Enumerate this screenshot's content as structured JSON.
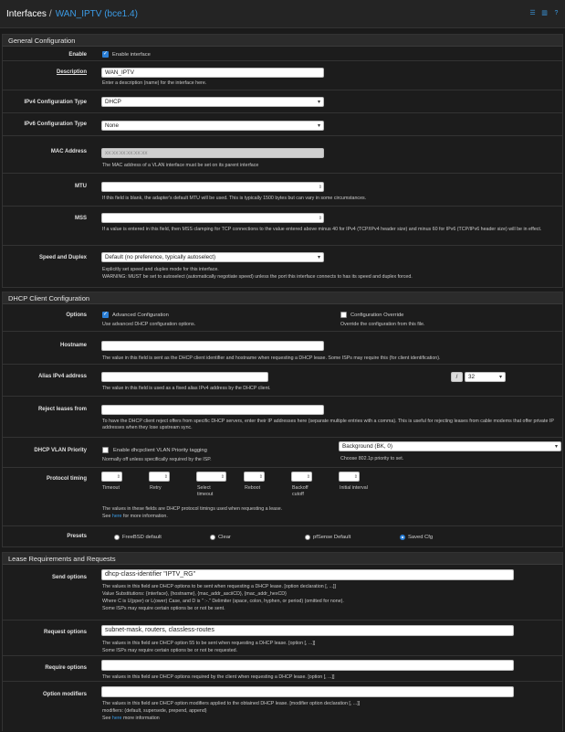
{
  "header": {
    "title": "Interfaces",
    "separator": "/",
    "subtitle": "WAN_IPTV (bce1.4)"
  },
  "general": {
    "heading": "General Configuration",
    "enable": {
      "label": "Enable",
      "text": "Enable interface"
    },
    "description": {
      "label": "Description",
      "value": "WAN_IPTV",
      "help": "Enter a description (name) for the interface here."
    },
    "ipv4": {
      "label": "IPv4 Configuration Type",
      "value": "DHCP"
    },
    "ipv6": {
      "label": "IPv6 Configuration Type",
      "value": "None"
    },
    "mac": {
      "label": "MAC Address",
      "placeholder": "xx:xx:xx:xx:xx:xx",
      "help": "The MAC address of a VLAN interface must be set on its parent interface"
    },
    "mtu": {
      "label": "MTU",
      "help": "If this field is blank, the adapter's default MTU will be used. This is typically 1500 bytes but can vary in some circumstances."
    },
    "mss": {
      "label": "MSS",
      "help": "If a value is entered in this field, then MSS clamping for TCP connections to the value entered above minus 40 for IPv4 (TCP/IPv4 header size) and minus 60 for IPv6 (TCP/IPv6 header size) will be in effect."
    },
    "speed": {
      "label": "Speed and Duplex",
      "value": "Default (no preference, typically autoselect)",
      "help1": "Explicitly set speed and duplex mode for this interface.",
      "help2": "WARNING: MUST be set to autoselect (automatically negotiate speed) unless the port this interface connects to has its speed and duplex forced."
    }
  },
  "dhcp": {
    "heading": "DHCP Client Configuration",
    "options": {
      "label": "Options",
      "adv": "Advanced Configuration",
      "adv_help": "Use advanced DHCP configuration options.",
      "override": "Configuration Override",
      "override_help": "Override the configuration from this file."
    },
    "hostname": {
      "label": "Hostname",
      "help": "The value in this field is sent as the DHCP client identifier and hostname when requesting a DHCP lease. Some ISPs may require this (for client identification)."
    },
    "alias": {
      "label": "Alias IPv4 address",
      "slash": "/",
      "mask": "32",
      "help": "The value in this field is used as a fixed alias IPv4 address by the DHCP client."
    },
    "reject": {
      "label": "Reject leases from",
      "help": "To have the DHCP client reject offers from specific DHCP servers, enter their IP addresses here (separate multiple entries with a comma). This is useful for rejecting leases from cable modems that offer private IP addresses when they lose upstream sync."
    },
    "vlan": {
      "label": "DHCP VLAN Priority",
      "text": "Enable dhcpclient VLAN Priority tagging",
      "help": "Normally off unless specifically required by the ISP.",
      "prio": "Background (BK, 0)",
      "prio_help": "Choose 802.1p priority to set."
    },
    "timing": {
      "label": "Protocol timing",
      "fields": [
        "Timeout",
        "Retry",
        "Select timeout",
        "Reboot",
        "Backoff cutoff",
        "Initial interval"
      ],
      "help": "The values in these fields are DHCP protocol timings used when requesting a lease.",
      "see": "See ",
      "here": "here",
      "more": " for more information."
    },
    "presets": {
      "label": "Presets",
      "items": [
        "FreeBSD default",
        "Clear",
        "pfSense Default",
        "Saved Cfg"
      ]
    }
  },
  "lease": {
    "heading": "Lease Requirements and Requests",
    "send": {
      "label": "Send options",
      "value": "dhcp-class-identifier \"IPTV_RG\"",
      "help1": "The values in this field are DHCP options to be sent when requesting a DHCP lease. [option declaration [, ...]]",
      "help2": "Value Substitutions: {interface}, {hostname}, {mac_addr_asciiCD}, {mac_addr_hexCD}",
      "help3": "Where C is U(pper) or L(ower) Case, and D is \" :-.\" Delimiter (space, colon, hyphen, or period) (omitted for none).",
      "help4": "Some ISPs may require certain options be or not be sent."
    },
    "request": {
      "label": "Request options",
      "value": "subnet-mask, routers, classless-routes",
      "help1": "The values in this field are DHCP option 55 to be sent when requesting a DHCP lease. [option [, ...]]",
      "help2": "Some ISPs may require certain options be or not be requested."
    },
    "require": {
      "label": "Require options",
      "help": "The values in this field are DHCP options required by the client when requesting a DHCP lease. [option [, ...]]"
    },
    "modifiers": {
      "label": "Option modifiers",
      "help1": "The values in this field are DHCP option modifiers applied to the obtained DHCP lease. [modifier option declaration [, ...]]",
      "help2": "modifiers: (default, supersede, prepend, append)",
      "see": "See ",
      "here": "here",
      "more": " more information"
    }
  }
}
